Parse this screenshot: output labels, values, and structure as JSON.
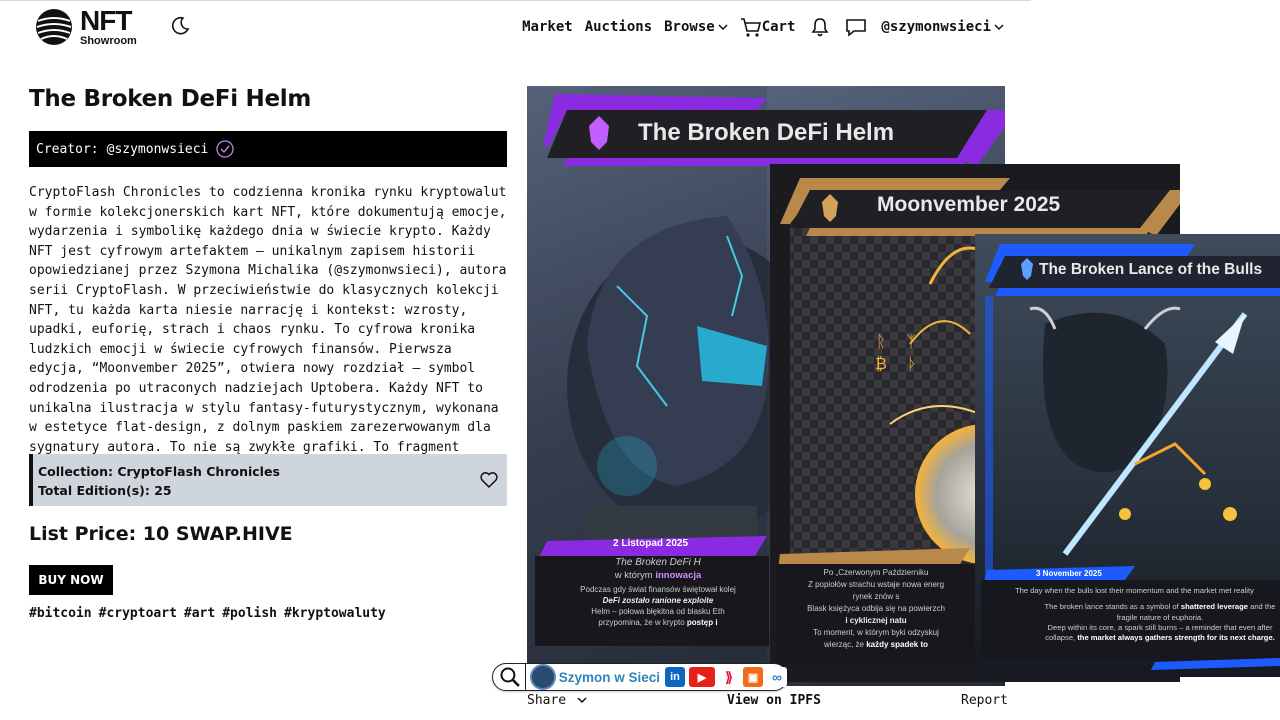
{
  "header": {
    "logo_main": "NFT",
    "logo_sub": "Showroom",
    "theme_icon": "moon-icon",
    "nav": {
      "market": "Market",
      "auctions": "Auctions",
      "browse": "Browse",
      "cart": "Cart",
      "user": "@szymonwsieci"
    }
  },
  "nft": {
    "title": "The Broken DeFi Helm",
    "creator_label": "Creator:",
    "creator": "@szymonwsieci",
    "description": "CryptoFlash Chronicles to codzienna kronika rynku kryptowalut w formie kolekcjonerskich kart NFT, które dokumentują emocje, wydarzenia i symbolikę każdego dnia w świecie krypto. Każdy NFT jest cyfrowym artefaktem – unikalnym zapisem historii opowiedzianej przez Szymona Michalika (@szymonwsieci), autora serii CryptoFlash. W przeciwieństwie do klasycznych kolekcji NFT, tu każda karta niesie narrację i kontekst: wzrosty, upadki, euforię, strach i chaos rynku. To cyfrowa kronika ludzkich emocji w świecie cyfrowych finansów. Pierwsza edycja, “Moonvember 2025”, otwiera nowy rozdział – symbol odrodzenia po utraconych nadziejach Uptobera. Każdy NFT to unikalna ilustracja w stylu fantasy-futurystycznym, wykonana w estetyce flat-design, z dolnym paskiem zarezerwowanym dla sygnatury autora. To nie są zwykłe grafiki. To fragment historii zapamiętany na blockchainie Hive.",
    "collection": "Collection: CryptoFlash Chronicles",
    "editions": "Total Edition(s): 25",
    "price": "List Price: 10 SWAP.HIVE",
    "buy_label": "BUY NOW",
    "tags": [
      "#bitcoin",
      "#cryptoart",
      "#art",
      "#polish",
      "#kryptowaluty"
    ]
  },
  "artwork": {
    "card1": {
      "title": "The Broken DeFi Helm",
      "date": "2 Listopad 2025",
      "line1": "The Broken DeFi H",
      "line2a": "w którym ",
      "line2b": "innowacja",
      "line3": "Podczas gdy świat finansów świętował kolej",
      "line4": "DeFi zostało ranione exploite",
      "line5": "Helm – połowa błękitna od blasku Eth",
      "line6a": "przypomina, że w krypto ",
      "line6b": "postęp i"
    },
    "card2": {
      "title": "Moonvember 2025",
      "line1": "Po „Czerwonym Październiku",
      "line2": "Z popiołów strachu wstaje nowa energ",
      "line3": "rynek znów s",
      "line4": "Blask księżyca odbija się na powierzch",
      "line5": "i cyklicznej natu",
      "line6": "To moment, w którym byki odzyskuj",
      "line7a": "wierząc, że ",
      "line7b": "każdy spadek to",
      "glyphs": "ᚱ ᛉ ₿ ᚦ"
    },
    "card3": {
      "title": "The Broken Lance of the Bulls",
      "date": "3 November 2025",
      "line1": "The day when the bulls lost their momentum and the market met reality",
      "line2a": "The broken lance stands as a symbol of ",
      "line2b": "shattered leverage",
      "line2c": " and the",
      "line3": "fragile nature of euphoria.",
      "line4": "Deep within its core, a spark still burns – a reminder that even after",
      "line5a": "collapse, ",
      "line5b": "the market always gathers strength for its next charge."
    }
  },
  "social_bar": {
    "search_icon": "magnifier-icon",
    "name": "Szymon w Sieci",
    "icons": [
      "linkedin-icon",
      "youtube-icon",
      "hive-icon",
      "bookmark-icon",
      "link-icon"
    ]
  },
  "footer": {
    "share": "Share",
    "ipfs": "View on IPFS",
    "report": "Report"
  },
  "colors": {
    "purple": "#8a2be2",
    "gold": "#b8894a",
    "blue": "#1e5bff",
    "collection_bg": "#cfd5dc"
  }
}
